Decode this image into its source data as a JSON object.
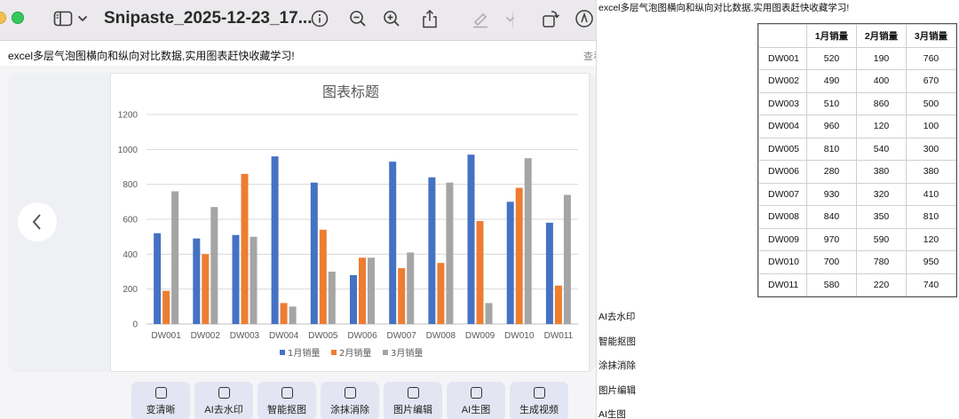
{
  "window": {
    "title": "Snipaste_2025-12-23_17..."
  },
  "post": {
    "caption": "excel多层气泡图横向和纵向对比数据,实用图表赶快收藏学习!",
    "view_more": "查看"
  },
  "toolbar": {
    "icons": [
      "sidebar-toggle-icon",
      "chevron-down-icon",
      "info-icon",
      "zoom-out-icon",
      "zoom-in-icon",
      "share-icon",
      "highlight-pen-icon",
      "rotate-icon",
      "markup-icon"
    ]
  },
  "chart_data": {
    "type": "bar",
    "title": "图表标题",
    "categories": [
      "DW001",
      "DW002",
      "DW003",
      "DW004",
      "DW005",
      "DW006",
      "DW007",
      "DW008",
      "DW009",
      "DW010",
      "DW011"
    ],
    "series": [
      {
        "name": "1月销量",
        "color": "#4472c4",
        "values": [
          520,
          490,
          510,
          960,
          810,
          280,
          930,
          840,
          970,
          700,
          580
        ]
      },
      {
        "name": "2月销量",
        "color": "#ed7d31",
        "values": [
          190,
          400,
          860,
          120,
          540,
          380,
          320,
          350,
          590,
          780,
          220
        ]
      },
      {
        "name": "3月销量",
        "color": "#a5a5a5",
        "values": [
          760,
          670,
          500,
          100,
          300,
          380,
          410,
          810,
          120,
          950,
          740
        ]
      }
    ],
    "ylim": [
      0,
      1200
    ],
    "yticks": [
      0,
      200,
      400,
      600,
      800,
      1000,
      1200
    ],
    "grid": true,
    "legend": "bottom"
  },
  "tools": [
    {
      "label": "变清晰",
      "icon": "hd-icon"
    },
    {
      "label": "AI去水印",
      "icon": "ai-watermark-icon"
    },
    {
      "label": "智能抠图",
      "icon": "cutout-icon"
    },
    {
      "label": "涂抹消除",
      "icon": "eraser-icon"
    },
    {
      "label": "图片编辑",
      "icon": "image-edit-icon"
    },
    {
      "label": "AI生图",
      "icon": "ai-image-icon"
    },
    {
      "label": "生成视频",
      "icon": "video-icon"
    }
  ],
  "right_panel": {
    "caption": "excel多层气泡图横向和纵向对比数据,实用图表赶快收藏学习!",
    "table": {
      "headers": [
        "",
        "1月销量",
        "2月销量",
        "3月销量"
      ],
      "rows": [
        [
          "DW001",
          "520",
          "190",
          "760"
        ],
        [
          "DW002",
          "490",
          "400",
          "670"
        ],
        [
          "DW003",
          "510",
          "860",
          "500"
        ],
        [
          "DW004",
          "960",
          "120",
          "100"
        ],
        [
          "DW005",
          "810",
          "540",
          "300"
        ],
        [
          "DW006",
          "280",
          "380",
          "380"
        ],
        [
          "DW007",
          "930",
          "320",
          "410"
        ],
        [
          "DW008",
          "840",
          "350",
          "810"
        ],
        [
          "DW009",
          "970",
          "590",
          "120"
        ],
        [
          "DW010",
          "700",
          "780",
          "950"
        ],
        [
          "DW011",
          "580",
          "220",
          "740"
        ]
      ]
    },
    "items": [
      "AI去水印",
      "智能抠图",
      "涂抹消除",
      "图片编辑",
      "AI生图"
    ]
  }
}
